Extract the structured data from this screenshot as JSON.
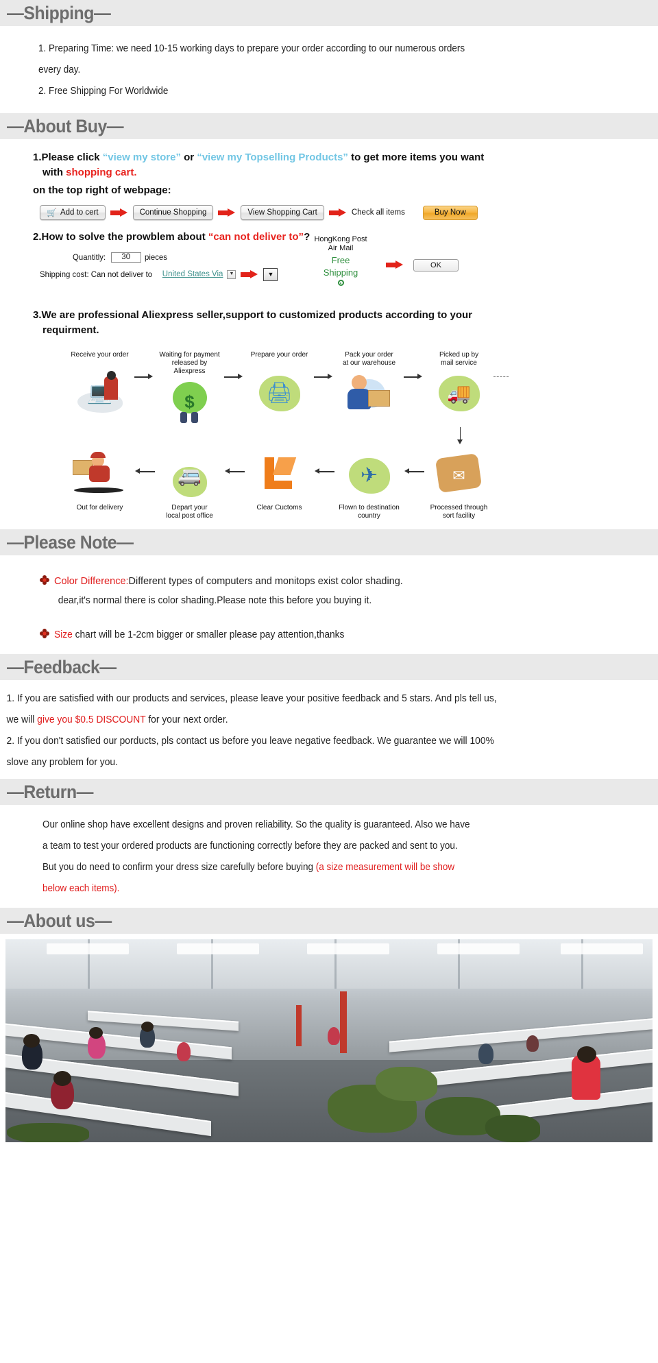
{
  "sections": {
    "shipping": {
      "title": "Shipping",
      "dash": "—",
      "lines": [
        "1. Preparing Time: we need 10-15 working days to prepare your order according to our numerous orders",
        "every day.",
        "2. Free Shipping For Worldwide"
      ]
    },
    "about_buy": {
      "title": "About Buy",
      "item1": {
        "prefix": "1.Please click ",
        "link1": "“view my store”",
        "mid": " or ",
        "link2": "“view my Topselling Products”",
        "suffix": " to get more items you want",
        "line2_prefix": "with ",
        "line2_red": "shopping cart.",
        "line3": "on the top right of webpage:"
      },
      "buttons": {
        "add_to_cart": "Add to cert",
        "cart_icon": "shopping-cart-icon",
        "continue_shopping": "Continue Shopping",
        "view_shopping_cart": "View Shopping Cart",
        "check_all_items": "Check all items",
        "buy_now": "Buy Now"
      },
      "item2": {
        "prefix": "2.How to solve the prowblem about ",
        "red": "“can not deliver to”",
        "suffix": "?",
        "quantity_label": "Quantitly:",
        "quantity_value": "30",
        "pieces_label": "pieces",
        "shipping_label": "Shipping cost: Can not deliver to",
        "country_value": "United States Via",
        "dropdown_glyph": "▼",
        "carrier_line1": "HongKong Post",
        "carrier_line2": "Air Mail",
        "free_line1": "Free",
        "free_line2": "Shipping",
        "ok_label": "OK"
      },
      "item3": {
        "line1": "3.We are professional Aliexpress seller,support to customized products according to your",
        "line2": "requirment."
      },
      "flow_top": [
        {
          "caption": "Receive your order",
          "icon": "desk-computer-icon",
          "glyph": "👩‍💻"
        },
        {
          "caption": "Waiting for payment\nreleased by Aliexpress",
          "icon": "money-bag-icon",
          "glyph": "💰"
        },
        {
          "caption": "Prepare your order",
          "icon": "printer-icon",
          "glyph": "🖨"
        },
        {
          "caption": "Pack your order\nat our warehouse",
          "icon": "packer-icon",
          "glyph": "📦"
        },
        {
          "caption": "Picked up by\nmail service",
          "icon": "mail-truck-icon",
          "glyph": "🚚"
        }
      ],
      "flow_bottom": [
        {
          "caption": "Out for delivery",
          "icon": "delivery-runner-icon",
          "glyph": "🏃"
        },
        {
          "caption": "Depart your\nlocal post office",
          "icon": "post-van-icon",
          "glyph": "🚐"
        },
        {
          "caption": "Clear Cuctoms",
          "icon": "customs-icon",
          "glyph": "🛡"
        },
        {
          "caption": "Flown to destination\ncountry",
          "icon": "airplane-icon",
          "glyph": "✈"
        },
        {
          "caption": "Processed through\nsort facility",
          "icon": "mail-sort-icon",
          "glyph": "✉"
        }
      ]
    },
    "please_note": {
      "title": "Please Note",
      "items": [
        {
          "bullet": "flower-bullet-icon",
          "red": "Color Difference:",
          "rest": "Different types of computers and monitops exist color shading.",
          "line2": "dear,it's normal there is color shading.Please note this before you buying it."
        },
        {
          "bullet": "flower-bullet-icon",
          "red": "Size",
          "rest": " chart will be 1-2cm bigger or smaller please pay attention,thanks",
          "line2": ""
        }
      ]
    },
    "feedback": {
      "title": "Feedback",
      "l1": "1. If you are satisfied with our products and services, please leave your positive feedback and 5 stars. And pls tell us,",
      "l2_prefix": "we will ",
      "l2_red": "give you $0.5  DISCOUNT",
      "l2_suffix": " for your next order.",
      "l3": "2. If you don't satisfied our porducts, pls contact us before you leave negative feedback. We guarantee we will 100%",
      "l4": "slove any problem for you."
    },
    "return": {
      "title": "Return",
      "l1": "Our online shop have excellent designs and proven reliability. So the quality is guaranteed. Also we have",
      "l2": "a team to test your ordered products are functioning correctly before they are packed and sent to you.",
      "l3_prefix": "But you do need to confirm your dress size carefully before buying ",
      "l3_red": "(a size measurement will be show",
      "l4_red": "below each items)."
    },
    "about_us": {
      "title": "About us",
      "photo_alt": "garment-factory-workshop-photo"
    }
  },
  "colors": {
    "bar_bg": "#e9e9e9",
    "bar_text": "#6d6d6d",
    "red": "#e01b1b",
    "link_blue": "#72c6e4",
    "green": "#2f8f3e",
    "buy_now": "#f0a828"
  }
}
